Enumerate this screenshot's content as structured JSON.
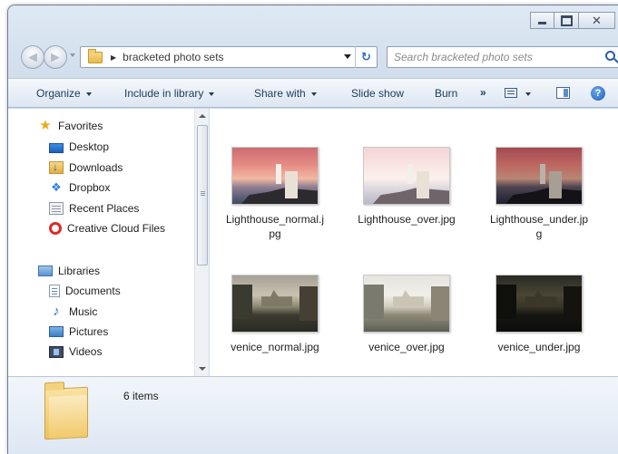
{
  "window": {
    "caption_buttons": {
      "close_glyph": "✕"
    }
  },
  "address": {
    "breadcrumb": "bracketed photo sets",
    "refresh_glyph": "↻"
  },
  "search": {
    "placeholder": "Search bracketed photo sets"
  },
  "toolbar": {
    "organize": "Organize",
    "include_in_library": "Include in library",
    "share_with": "Share with",
    "slide_show": "Slide show",
    "burn": "Burn",
    "more": "»",
    "help": "?"
  },
  "nav": {
    "favorites_header": "Favorites",
    "favorites": [
      {
        "label": "Desktop",
        "icon": "desktop-icon"
      },
      {
        "label": "Downloads",
        "icon": "downloads-folder-icon"
      },
      {
        "label": "Dropbox",
        "icon": "dropbox-icon"
      },
      {
        "label": "Recent Places",
        "icon": "recent-places-icon"
      },
      {
        "label": "Creative Cloud Files",
        "icon": "creative-cloud-icon"
      }
    ],
    "libraries_header": "Libraries",
    "libraries": [
      {
        "label": "Documents",
        "icon": "documents-icon"
      },
      {
        "label": "Music",
        "icon": "music-icon"
      },
      {
        "label": "Pictures",
        "icon": "pictures-icon"
      },
      {
        "label": "Videos",
        "icon": "videos-icon"
      }
    ]
  },
  "files": [
    {
      "name": "Lighthouse_normal.jpg",
      "thumb": "lighthouse-normal"
    },
    {
      "name": "Lighthouse_over.jpg",
      "thumb": "lighthouse-over"
    },
    {
      "name": "Lighthouse_under.jpg",
      "thumb": "lighthouse-under"
    },
    {
      "name": "venice_normal.jpg",
      "thumb": "venice-normal"
    },
    {
      "name": "venice_over.jpg",
      "thumb": "venice-over"
    },
    {
      "name": "venice_under.jpg",
      "thumb": "venice-under"
    }
  ],
  "details": {
    "item_count": "6 items"
  },
  "colors": {
    "toolbar_text": "#1e395b",
    "frame": "#cfdceb",
    "accent": "#2a5fa8"
  }
}
